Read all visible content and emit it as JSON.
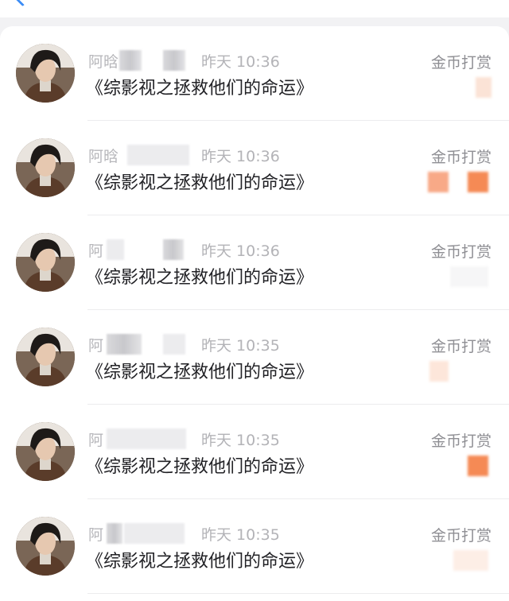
{
  "header": {
    "back_icon": "chevron-left-icon",
    "accent_color": "#3b8cf5"
  },
  "rows": [
    {
      "name": "阿晗",
      "time": "昨天 10:36",
      "title": "《综影视之拯救他们的命运》",
      "reward_label": "金币打赏"
    },
    {
      "name": "阿晗",
      "time": "昨天 10:36",
      "title": "《综影视之拯救他们的命运》",
      "reward_label": "金币打赏"
    },
    {
      "name": "阿",
      "time": "昨天 10:36",
      "title": "《综影视之拯救他们的命运》",
      "reward_label": "金币打赏"
    },
    {
      "name": "阿",
      "time": "昨天 10:35",
      "title": "《综影视之拯救他们的命运》",
      "reward_label": "金币打赏"
    },
    {
      "name": "阿",
      "time": "昨天 10:35",
      "title": "《综影视之拯救他们的命运》",
      "reward_label": "金币打赏"
    },
    {
      "name": "阿",
      "time": "昨天 10:35",
      "title": "《综影视之拯救他们的命运》",
      "reward_label": "金币打赏"
    }
  ]
}
